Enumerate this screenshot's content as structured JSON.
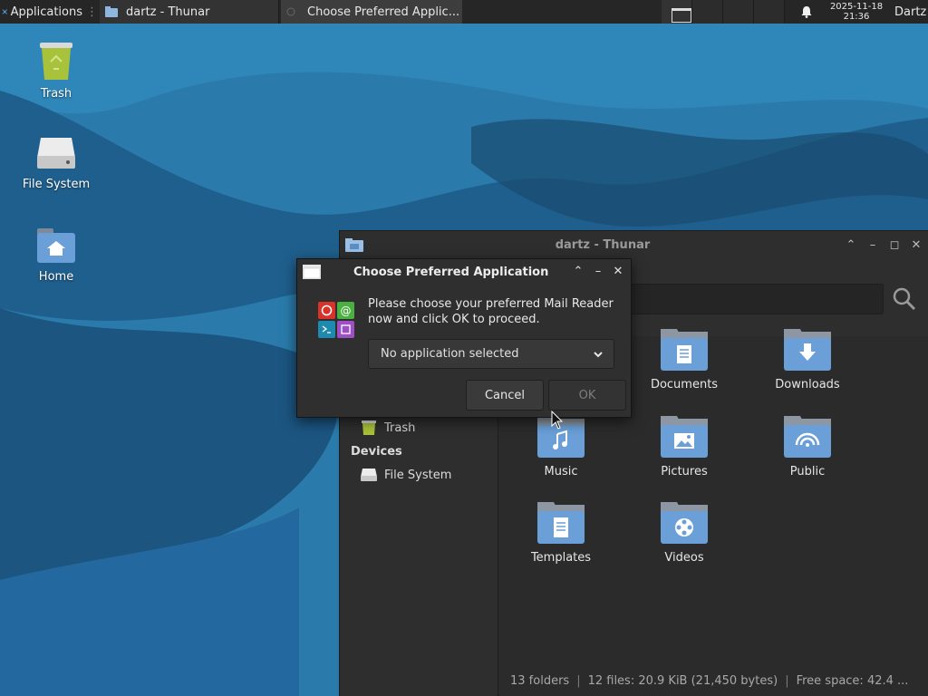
{
  "panel": {
    "applications_label": "Applications",
    "tasks": [
      {
        "label": "dartz - Thunar"
      },
      {
        "label": "Choose Preferred Applic..."
      }
    ],
    "clock": {
      "date": "2025-11-18",
      "time": "21:36"
    },
    "user": "Dartz",
    "icons": {
      "app_menu": "xfce-mouse-icon",
      "notification": "bell-icon"
    }
  },
  "desktop": {
    "icons": [
      {
        "label": "Trash",
        "icon": "trash-icon"
      },
      {
        "label": "File System",
        "icon": "drive-icon"
      },
      {
        "label": "Home",
        "icon": "home-folder-icon"
      }
    ]
  },
  "thunar": {
    "title": "dartz - Thunar",
    "sidebar": {
      "trash_label": "Trash",
      "devices_heading": "Devices",
      "filesystem_label": "File System"
    },
    "folders": [
      {
        "name": "Documents",
        "icon": "documents-folder-icon"
      },
      {
        "name": "Downloads",
        "icon": "downloads-folder-icon"
      },
      {
        "name": "Music",
        "icon": "music-folder-icon"
      },
      {
        "name": "Pictures",
        "icon": "pictures-folder-icon"
      },
      {
        "name": "Public",
        "icon": "public-folder-icon"
      },
      {
        "name": "Templates",
        "icon": "templates-folder-icon"
      },
      {
        "name": "Videos",
        "icon": "videos-folder-icon"
      }
    ],
    "status": {
      "folders": "13 folders",
      "files": "12 files: 20.9 KiB (21,450 bytes)",
      "free": "Free space: 42.4 ..."
    }
  },
  "dialog": {
    "title": "Choose Preferred Application",
    "message": "Please choose your preferred Mail Reader now and click OK to proceed.",
    "select_value": "No application selected",
    "cancel_label": "Cancel",
    "ok_label": "OK",
    "ok_enabled": false
  },
  "colors": {
    "panel_bg": "#262626",
    "window_bg": "#2b2b2b",
    "folder_blue": "#6a9fd8",
    "wallpaper_light": "#2f86b8",
    "wallpaper_dark": "#1d4e72"
  }
}
